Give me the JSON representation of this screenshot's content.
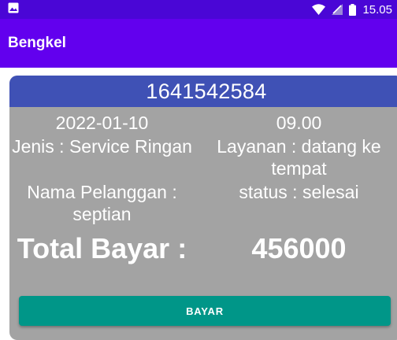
{
  "status_bar": {
    "time": "15.05",
    "icons": [
      "image-icon",
      "wifi-icon",
      "signal-icon",
      "battery-icon"
    ]
  },
  "app_bar": {
    "title": "Bengkel"
  },
  "order": {
    "id": "1641542584",
    "date": "2022-01-10",
    "time": "09.00",
    "type": "Jenis : Service Ringan",
    "service": "Layanan : datang ke tempat",
    "customer": "Nama Pelanggan : septian",
    "status": "status : selesai",
    "total_label": "Total Bayar :",
    "total_value": "456000",
    "pay_label": "BAYAR"
  },
  "colors": {
    "status_bar": "#4a06d6",
    "app_bar": "#6200ee",
    "card_header": "#3f51b5",
    "card_body": "#a3a3a3",
    "button": "#009688"
  }
}
